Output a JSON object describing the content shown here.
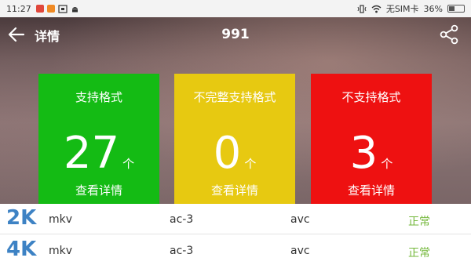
{
  "status_bar": {
    "time": "11:27",
    "sim_status": "无SIM卡",
    "battery": "36%",
    "icons": [
      "notification-red-icon",
      "notification-orange-icon",
      "screenshot-icon",
      "android-icon",
      "vibrate-icon",
      "wifi-icon",
      "battery-icon"
    ]
  },
  "app_bar": {
    "title": "详情",
    "center_title": "991",
    "back_icon": "back-arrow-icon",
    "share_icon": "share-icon"
  },
  "colors": {
    "supported": "#14bb14",
    "incomplete": "#e7c911",
    "unsupported": "#ee1111",
    "resolution": "#3d82c4",
    "status_ok": "#73b73a"
  },
  "cards": [
    {
      "title": "支持格式",
      "count": "27",
      "unit": "个",
      "detail": "查看详情"
    },
    {
      "title": "不完整支持格式",
      "count": "0",
      "unit": "个",
      "detail": "查看详情"
    },
    {
      "title": "不支持格式",
      "count": "3",
      "unit": "个",
      "detail": "查看详情"
    }
  ],
  "rows": [
    {
      "resolution": "2K",
      "container": "mkv",
      "audio": "ac-3",
      "video": "avc",
      "status": "正常"
    },
    {
      "resolution": "4K",
      "container": "mkv",
      "audio": "ac-3",
      "video": "avc",
      "status": "正常"
    }
  ]
}
